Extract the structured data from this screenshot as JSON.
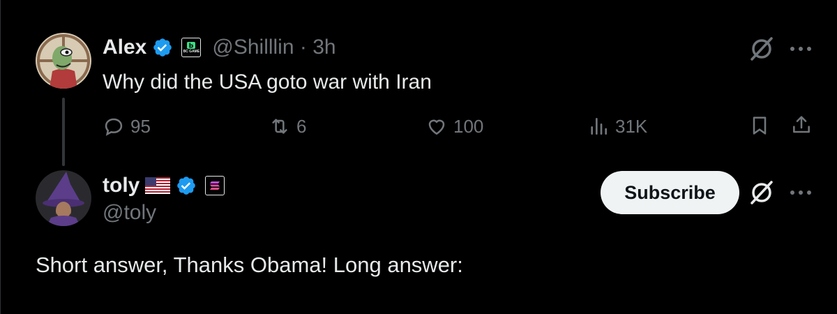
{
  "post1": {
    "name": "Alex",
    "affiliate_badge": "BC GAME",
    "handle_time": "@Shilllin · 3h",
    "text": "Why did the USA goto war with Iran",
    "metrics": {
      "replies": "95",
      "reposts": "6",
      "likes": "100",
      "views": "31K"
    }
  },
  "post2": {
    "name": "toly",
    "flag": "US flag",
    "handle": "@toly",
    "subscribe_label": "Subscribe",
    "text": "Short answer, Thanks Obama!  Long answer:"
  },
  "icons": [
    "grok-icon",
    "more-icon",
    "reply-icon",
    "repost-icon",
    "like-icon",
    "views-icon",
    "bookmark-icon",
    "share-icon",
    "verified-badge-icon",
    "flag-icon"
  ],
  "colors": {
    "background": "#000000",
    "text": "#e7e9ea",
    "muted": "#71767b",
    "verified": "#1d9bf0",
    "button_bg": "#eff3f4"
  }
}
